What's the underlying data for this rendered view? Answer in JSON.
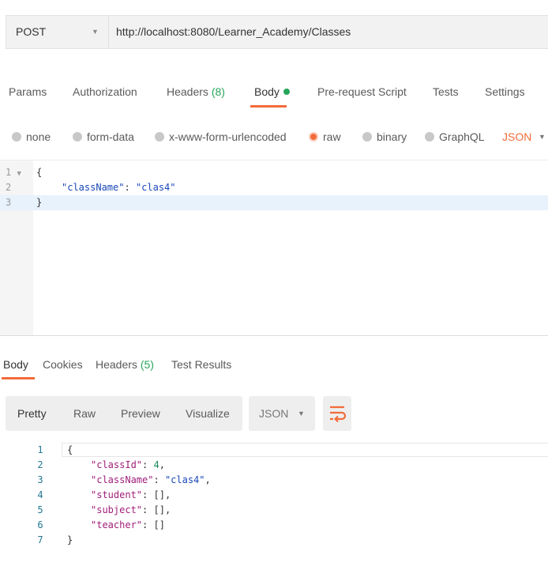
{
  "request": {
    "method": "POST",
    "url": "http://localhost:8080/Learner_Academy/Classes"
  },
  "request_tabs": [
    {
      "label": "Params"
    },
    {
      "label": "Authorization"
    },
    {
      "label": "Headers",
      "count": "(8)"
    },
    {
      "label": "Body"
    },
    {
      "label": "Pre-request Script"
    },
    {
      "label": "Tests"
    },
    {
      "label": "Settings"
    }
  ],
  "body_types": [
    {
      "label": "none",
      "selected": false
    },
    {
      "label": "form-data",
      "selected": false
    },
    {
      "label": "x-www-form-urlencoded",
      "selected": false
    },
    {
      "label": "raw",
      "selected": true
    },
    {
      "label": "binary",
      "selected": false
    },
    {
      "label": "GraphQL",
      "selected": false
    }
  ],
  "raw_format": "JSON",
  "editor": {
    "line_numbers": [
      "1",
      "2",
      "3"
    ],
    "lines": [
      "{",
      "\"className\"",
      ": ",
      "\"clas4\"",
      "}"
    ]
  },
  "response_tabs": [
    {
      "label": "Body"
    },
    {
      "label": "Cookies"
    },
    {
      "label": "Headers",
      "count": "(5)"
    },
    {
      "label": "Test Results"
    }
  ],
  "response_views": [
    "Pretty",
    "Raw",
    "Preview",
    "Visualize"
  ],
  "response_format": "JSON",
  "response": {
    "line_numbers": [
      "1",
      "2",
      "3",
      "4",
      "5",
      "6",
      "7"
    ],
    "open_brace": "{",
    "close_brace": "}",
    "classId_key": "\"classId\"",
    "classId_val": "4",
    "className_key": "\"className\"",
    "className_val": "\"clas4\"",
    "student_key": "\"student\"",
    "subject_key": "\"subject\"",
    "teacher_key": "\"teacher\"",
    "empty_array": "[]"
  },
  "colors": {
    "accent": "#f26b3a",
    "green": "#26a65b"
  }
}
